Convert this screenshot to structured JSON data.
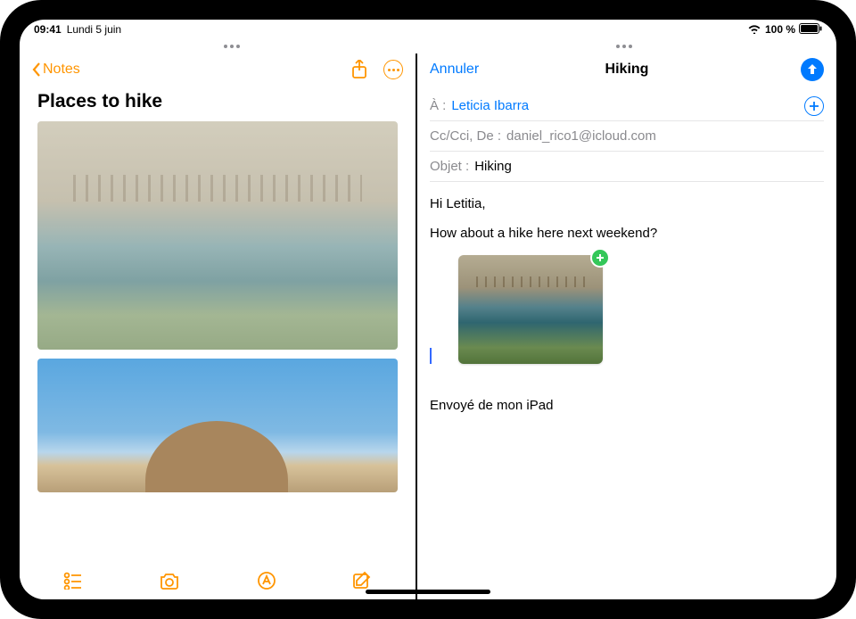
{
  "status": {
    "time": "09:41",
    "date": "Lundi 5 juin",
    "battery_text": "100 %"
  },
  "notes": {
    "back_label": "Notes",
    "title": "Places to hike"
  },
  "mail": {
    "cancel_label": "Annuler",
    "title": "Hiking",
    "to_label": "À :",
    "to_recipient": "Leticia Ibarra",
    "cc_label": "Cc/Cci, De :",
    "cc_value": "daniel_rico1@icloud.com",
    "subject_label": "Objet :",
    "subject_value": "Hiking",
    "body_line1": "Hi Letitia,",
    "body_line2": "How about a hike here next weekend?",
    "signature": "Envoyé de mon iPad"
  }
}
